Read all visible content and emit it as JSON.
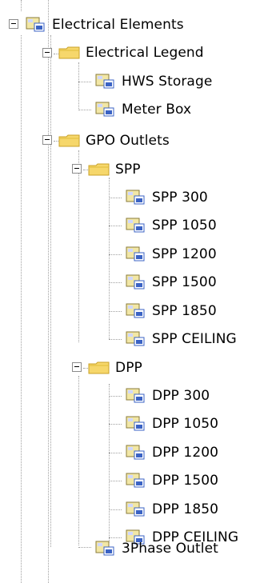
{
  "tree": {
    "root": {
      "label": "Electrical Elements",
      "icon": "electrical-element-icon",
      "expanded": true,
      "children": [
        {
          "label": "Electrical Legend",
          "icon": "folder-icon",
          "expanded": true,
          "children": [
            {
              "label": "HWS Storage",
              "icon": "electrical-element-icon"
            },
            {
              "label": "Meter Box",
              "icon": "electrical-element-icon"
            }
          ]
        },
        {
          "label": "GPO Outlets",
          "icon": "folder-icon",
          "expanded": true,
          "children": [
            {
              "label": "SPP",
              "icon": "folder-icon",
              "expanded": true,
              "children": [
                {
                  "label": "SPP 300",
                  "icon": "electrical-element-icon"
                },
                {
                  "label": "SPP 1050",
                  "icon": "electrical-element-icon"
                },
                {
                  "label": "SPP 1200",
                  "icon": "electrical-element-icon"
                },
                {
                  "label": "SPP 1500",
                  "icon": "electrical-element-icon"
                },
                {
                  "label": "SPP 1850",
                  "icon": "electrical-element-icon"
                },
                {
                  "label": "SPP CEILING",
                  "icon": "electrical-element-icon"
                }
              ]
            },
            {
              "label": "DPP",
              "icon": "folder-icon",
              "expanded": true,
              "children": [
                {
                  "label": "DPP 300",
                  "icon": "electrical-element-icon"
                },
                {
                  "label": "DPP 1050",
                  "icon": "electrical-element-icon"
                },
                {
                  "label": "DPP 1200",
                  "icon": "electrical-element-icon"
                },
                {
                  "label": "DPP 1500",
                  "icon": "electrical-element-icon"
                },
                {
                  "label": "DPP 1850",
                  "icon": "electrical-element-icon"
                },
                {
                  "label": "DPP CEILING",
                  "icon": "electrical-element-icon"
                }
              ]
            },
            {
              "label": "3Phase Outlet",
              "icon": "electrical-element-icon"
            }
          ]
        }
      ]
    }
  },
  "colors": {
    "guide_line": "#a0a0a0",
    "folder_fill": "#f6d76b",
    "folder_edge": "#c9a227",
    "element_fill": "#f2e7a6",
    "element_accent": "#3b63c4"
  }
}
